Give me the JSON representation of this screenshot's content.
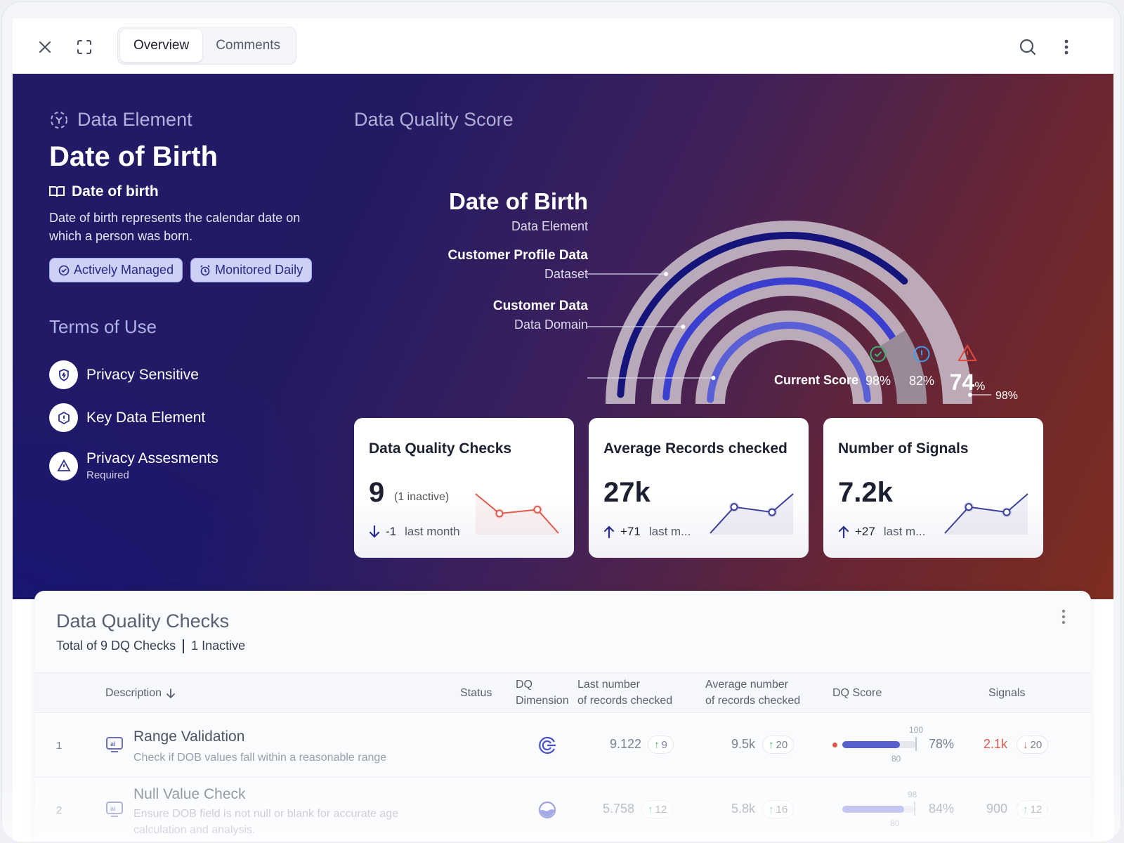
{
  "tabs": [
    {
      "label": "Overview",
      "active": true
    },
    {
      "label": "Comments",
      "active": false
    }
  ],
  "element": {
    "section_label": "Data Element",
    "title": "Date of Birth",
    "glossary_term": "Date of birth",
    "description": "Date of birth represents the calendar date on which a person was born.",
    "chips": [
      "Actively Managed",
      "Monitored Daily"
    ]
  },
  "terms": {
    "title": "Terms of Use",
    "items": [
      {
        "label": "Privacy Sensitive",
        "icon": "shield-icon"
      },
      {
        "label": "Key Data Element",
        "icon": "hexagon-alert-icon"
      },
      {
        "label": "Privacy Assesments",
        "sub": "Required",
        "icon": "warning-triangle-icon"
      }
    ]
  },
  "score": {
    "title": "Data Quality Score",
    "levels": [
      {
        "name": "Date of Birth",
        "type": "Data Element",
        "value": 74
      },
      {
        "name": "Customer Profile Data",
        "type": "Dataset",
        "value": 82
      },
      {
        "name": "Customer Data",
        "type": "Data Domain",
        "value": 98
      }
    ],
    "marker": "98%",
    "current_label": "Current Score",
    "current": [
      {
        "value": "98%",
        "icon": "check-circle-icon",
        "color": "#3bb273"
      },
      {
        "value": "82%",
        "icon": "info-circle-icon",
        "color": "#3a9ef0"
      },
      {
        "value": "74",
        "unit": "%",
        "icon": "warning-triangle-icon",
        "color": "#e5483d"
      }
    ]
  },
  "cards": [
    {
      "title": "Data Quality Checks",
      "value": "9",
      "note": "(1 inactive)",
      "delta": "-1",
      "delta_dir": "down",
      "period": "last month",
      "trend_color": "#e05a4c",
      "trend": [
        6,
        3,
        3.6,
        0
      ]
    },
    {
      "title": "Average Records checked",
      "value": "27k",
      "delta": "+71",
      "delta_dir": "up",
      "period": "last m...",
      "trend_color": "#3c3f9c",
      "trend": [
        0,
        4,
        3.2,
        6
      ]
    },
    {
      "title": "Number of Signals",
      "value": "7.2k",
      "delta": "+27",
      "delta_dir": "up",
      "period": "last m...",
      "trend_color": "#3c3f9c",
      "trend": [
        0,
        4,
        3.2,
        6
      ]
    }
  ],
  "table": {
    "title": "Data Quality Checks",
    "total": "Total of 9 DQ Checks",
    "inactive": "1 Inactive",
    "columns": {
      "description": "Description",
      "status": "Status",
      "dimension_1": "DQ",
      "dimension_2": "Dimension",
      "last_1": "Last number",
      "last_2": "of records checked",
      "avg_1": "Average number",
      "avg_2": "of records checked",
      "score": "DQ Score",
      "signals": "Signals"
    },
    "rows": [
      {
        "num": "1",
        "name": "Range Validation",
        "desc": "Check if DOB values fall within a reasonable range",
        "last": "9.122",
        "last_delta": "9",
        "avg": "9.5k",
        "avg_delta": "20",
        "score": "78%",
        "score_value": 78,
        "score_target": "100",
        "score_min": "80",
        "signals": "2.1k",
        "signals_delta": "20",
        "signals_dir": "down",
        "alert": true
      },
      {
        "num": "2",
        "name": "Null Value Check",
        "desc": "Ensure DOB field is not null or blank for accurate age calculation and analysis.",
        "last": "5.758",
        "last_delta": "12",
        "avg": "5.8k",
        "avg_delta": "16",
        "score": "84%",
        "score_value": 84,
        "score_target": "98",
        "score_min": "80",
        "signals": "900",
        "signals_delta": "12",
        "signals_dir": "up",
        "alert": false
      }
    ]
  }
}
